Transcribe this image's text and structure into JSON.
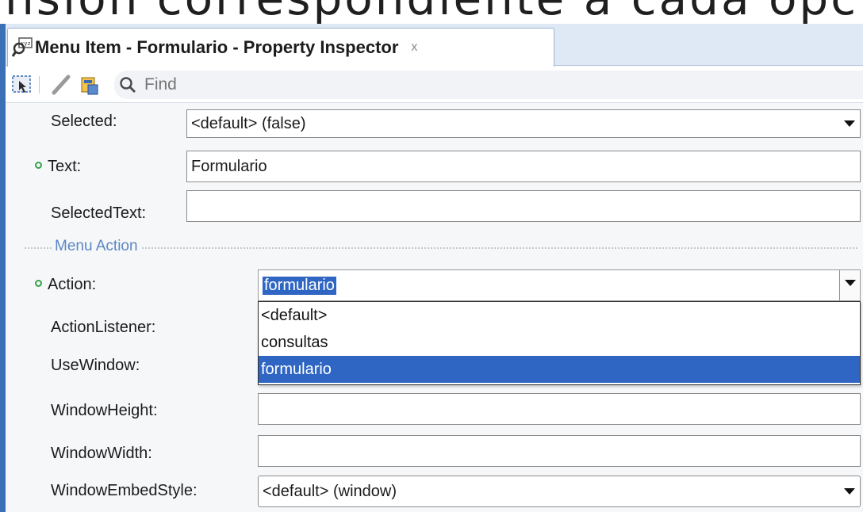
{
  "background_text": "nsión correspondiente a cada opc",
  "window": {
    "tab_title": "Menu Item - Formulario - Property Inspector",
    "tab_close": "x"
  },
  "toolbar": {
    "search_placeholder": "Find"
  },
  "properties": {
    "selected_label": "Selected:",
    "selected_value": "<default> (false)",
    "text_label": "Text:",
    "text_value": "Formulario",
    "selectedtext_label": "SelectedText:",
    "selectedtext_value": ""
  },
  "menu_action": {
    "section_label": "Menu Action",
    "action_label": "Action:",
    "action_value": "formulario",
    "action_options": [
      "<default>",
      "consultas",
      "formulario"
    ],
    "actionlistener_label": "ActionListener:",
    "usewindow_label": "UseWindow:",
    "windowheight_label": "WindowHeight:",
    "windowheight_value": "",
    "windowwidth_label": "WindowWidth:",
    "windowwidth_value": "",
    "windowembedstyle_label": "WindowEmbedStyle:",
    "windowembedstyle_value": "<default> (window)"
  },
  "colors": {
    "selection": "#2f66c3",
    "section_text": "#5b87c4",
    "set_marker": "#34a34a",
    "frame_accent": "#3b6fb6"
  },
  "icons": [
    "property-inspector-icon",
    "close-icon",
    "select-component-icon",
    "edit-pencil-icon",
    "bind-data-icon",
    "search-icon",
    "dropdown-arrow-icon"
  ]
}
